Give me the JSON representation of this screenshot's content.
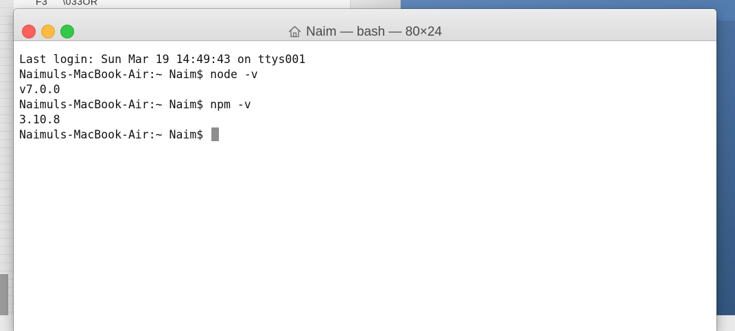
{
  "background": {
    "behind_window_label": "F3     \\033OR"
  },
  "window": {
    "title": "Naim — bash — 80×24",
    "title_icon": "home-icon",
    "traffic_lights": [
      {
        "name": "close",
        "color": "#fc605c"
      },
      {
        "name": "minimize",
        "color": "#fdbc40"
      },
      {
        "name": "zoom",
        "color": "#34c84a"
      }
    ]
  },
  "terminal": {
    "lines": [
      "Last login: Sun Mar 19 14:49:43 on ttys001",
      "Naimuls-MacBook-Air:~ Naim$ node -v",
      "v7.0.0",
      "Naimuls-MacBook-Air:~ Naim$ npm -v",
      "3.10.8"
    ],
    "prompt": "Naimuls-MacBook-Air:~ Naim$ "
  },
  "colors": {
    "desktop": "#4f78ab",
    "terminal_bg": "#ffffff",
    "terminal_text": "#111111",
    "cursor": "#8e8e8e"
  }
}
